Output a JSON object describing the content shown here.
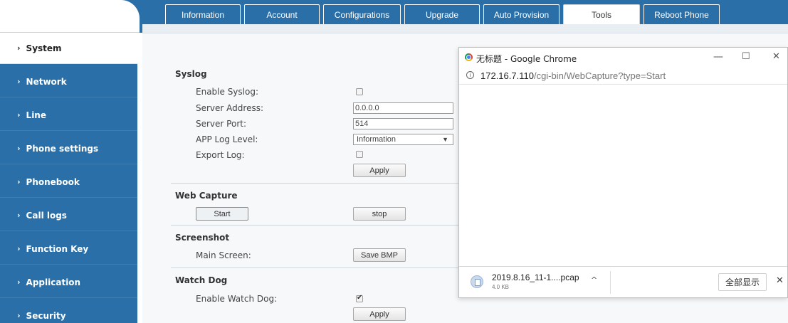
{
  "tabs": [
    {
      "label": "Information",
      "active": false
    },
    {
      "label": "Account",
      "active": false
    },
    {
      "label": "Configurations",
      "active": false
    },
    {
      "label": "Upgrade",
      "active": false
    },
    {
      "label": "Auto Provision",
      "active": false
    },
    {
      "label": "Tools",
      "active": true
    },
    {
      "label": "Reboot Phone",
      "active": false
    }
  ],
  "sidebar": {
    "items": [
      {
        "label": "System",
        "active": true
      },
      {
        "label": "Network",
        "active": false
      },
      {
        "label": "Line",
        "active": false
      },
      {
        "label": "Phone settings",
        "active": false
      },
      {
        "label": "Phonebook",
        "active": false
      },
      {
        "label": "Call logs",
        "active": false
      },
      {
        "label": "Function Key",
        "active": false
      },
      {
        "label": "Application",
        "active": false
      },
      {
        "label": "Security",
        "active": false
      }
    ]
  },
  "syslog": {
    "title": "Syslog",
    "enable_label": "Enable Syslog:",
    "enable_checked": false,
    "server_address_label": "Server Address:",
    "server_address_value": "0.0.0.0",
    "server_port_label": "Server Port:",
    "server_port_value": "514",
    "app_log_level_label": "APP Log Level:",
    "app_log_level_value": "Information",
    "export_log_label": "Export Log:",
    "export_log_checked": false,
    "apply_label": "Apply"
  },
  "web_capture": {
    "title": "Web Capture",
    "start_label": "Start",
    "stop_label": "stop"
  },
  "screenshot": {
    "title": "Screenshot",
    "main_screen_label": "Main Screen:",
    "save_label": "Save BMP"
  },
  "watch_dog": {
    "title": "Watch Dog",
    "enable_label": "Enable Watch Dog:",
    "enable_checked": true,
    "apply_label": "Apply"
  },
  "chrome": {
    "title": "无标题 - Google Chrome",
    "minimize": "—",
    "maximize": "☐",
    "close": "✕",
    "info_glyph": "i",
    "url_host": "172.16.7.110",
    "url_path": "/cgi-bin/WebCapture?type=Start",
    "download": {
      "file_name": "2019.8.16_11-1....pcap",
      "file_size": "4.0 KB",
      "caret": "^",
      "show_all_label": "全部显示",
      "close": "✕"
    }
  }
}
